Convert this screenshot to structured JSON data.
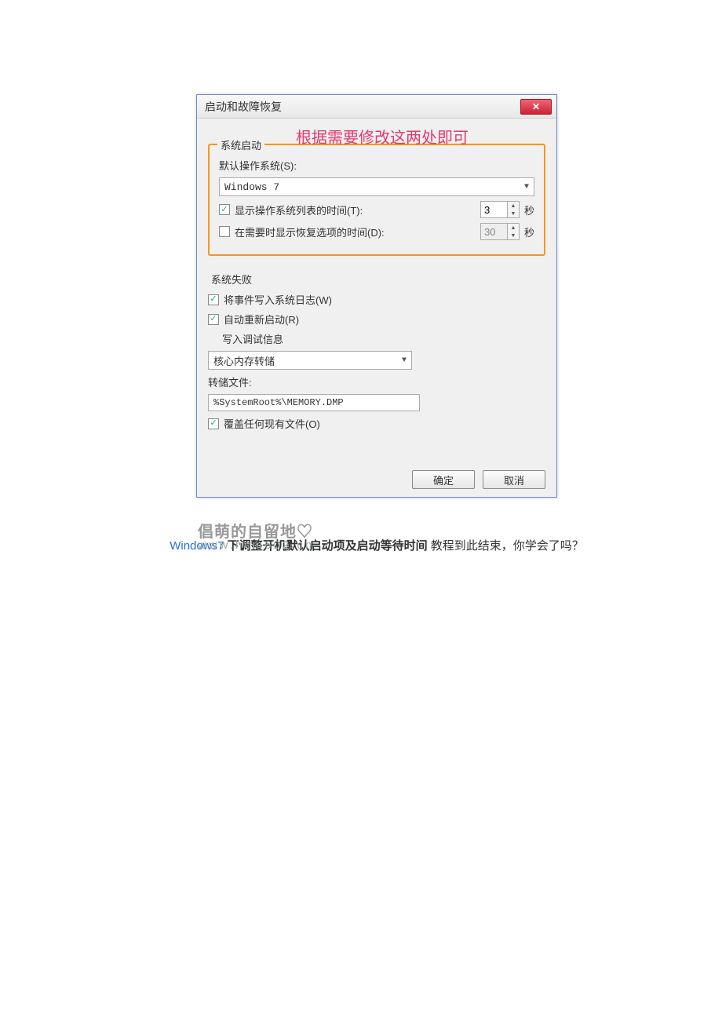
{
  "dialog": {
    "title": "启动和故障恢复",
    "annotation": "根据需要修改这两处即可",
    "startup": {
      "group_label": "系统启动",
      "default_os_label": "默认操作系统(S):",
      "default_os_value": "Windows 7",
      "show_os_list_checked": true,
      "show_os_list_label": "显示操作系统列表的时间(T):",
      "show_os_list_value": "3",
      "show_recovery_checked": false,
      "show_recovery_label": "在需要时显示恢复选项的时间(D):",
      "show_recovery_value": "30",
      "seconds_unit": "秒"
    },
    "failure": {
      "group_label": "系统失败",
      "write_log_checked": true,
      "write_log_label": "将事件写入系统日志(W)",
      "auto_restart_checked": true,
      "auto_restart_label": "自动重新启动(R)",
      "debug_info_label": "写入调试信息",
      "debug_type_value": "核心内存转储",
      "dump_file_label": "转储文件:",
      "dump_file_value": "%SystemRoot%\\MEMORY.DMP",
      "overwrite_checked": true,
      "overwrite_label": "覆盖任何现有文件(O)"
    },
    "buttons": {
      "ok": "确定",
      "cancel": "取消"
    }
  },
  "watermark": {
    "line1": "倡萌的自留地♡",
    "line2": "www.hcm602.cn"
  },
  "caption": {
    "keyword": "Windows7",
    "bold": " 下调整开机默认启动项及启动等待时间",
    "rest": " 教程到此结束，你学会了吗？"
  }
}
